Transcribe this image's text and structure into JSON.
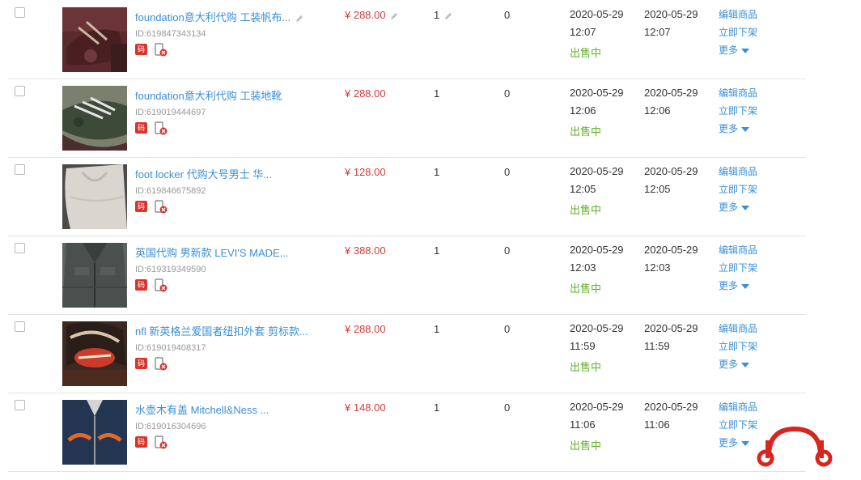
{
  "actions": {
    "edit_label": "编辑商品",
    "delist_label": "立即下架",
    "more_label": "更多"
  },
  "colors": {
    "link": "#3a8fd6",
    "price": "#d43b3b",
    "status_on_sale": "#61b12c",
    "badge_red": "#d9352d"
  },
  "products": [
    {
      "title": "foundation意大利代购 工装帆布...",
      "id": "ID:619847343134",
      "code_badge": "码",
      "price": "¥ 288.00",
      "quantity": "1",
      "sales": "0",
      "created_date": "2020-05-29",
      "created_time": "12:07",
      "updated_date": "2020-05-29",
      "updated_time": "12:07",
      "status": "出售中",
      "editable": true
    },
    {
      "title": "foundation意大利代购 工装地靴",
      "id": "ID:619019444697",
      "code_badge": "码",
      "price": "¥ 288.00",
      "quantity": "1",
      "sales": "0",
      "created_date": "2020-05-29",
      "created_time": "12:06",
      "updated_date": "2020-05-29",
      "updated_time": "12:06",
      "status": "出售中",
      "editable": false
    },
    {
      "title": "foot locker 代购大号男士 华...",
      "id": "ID:619846675892",
      "code_badge": "码",
      "price": "¥ 128.00",
      "quantity": "1",
      "sales": "0",
      "created_date": "2020-05-29",
      "created_time": "12:05",
      "updated_date": "2020-05-29",
      "updated_time": "12:05",
      "status": "出售中",
      "editable": false
    },
    {
      "title": "英国代购 男新款 LEVI'S MADE...",
      "id": "ID:619319349590",
      "code_badge": "码",
      "price": "¥ 388.00",
      "quantity": "1",
      "sales": "0",
      "created_date": "2020-05-29",
      "created_time": "12:03",
      "updated_date": "2020-05-29",
      "updated_time": "12:03",
      "status": "出售中",
      "editable": false
    },
    {
      "title": "nfl 新英格兰爱国者纽扣外套 剪标款...",
      "id": "ID:619019408317",
      "code_badge": "码",
      "price": "¥ 288.00",
      "quantity": "1",
      "sales": "0",
      "created_date": "2020-05-29",
      "created_time": "11:59",
      "updated_date": "2020-05-29",
      "updated_time": "11:59",
      "status": "出售中",
      "editable": false
    },
    {
      "title": "水壶木有盖 Mitchell&Ness ...",
      "id": "ID:619016304696",
      "code_badge": "码",
      "price": "¥ 148.00",
      "quantity": "1",
      "sales": "0",
      "created_date": "2020-05-29",
      "created_time": "11:06",
      "updated_date": "2020-05-29",
      "updated_time": "11:06",
      "status": "出售中",
      "editable": false
    }
  ],
  "thumbnails": [
    "brown-shoe-photo",
    "green-boot-photo",
    "white-shirt-photo",
    "denim-jacket-photo",
    "patriots-jacket-photo",
    "mets-jacket-photo"
  ]
}
